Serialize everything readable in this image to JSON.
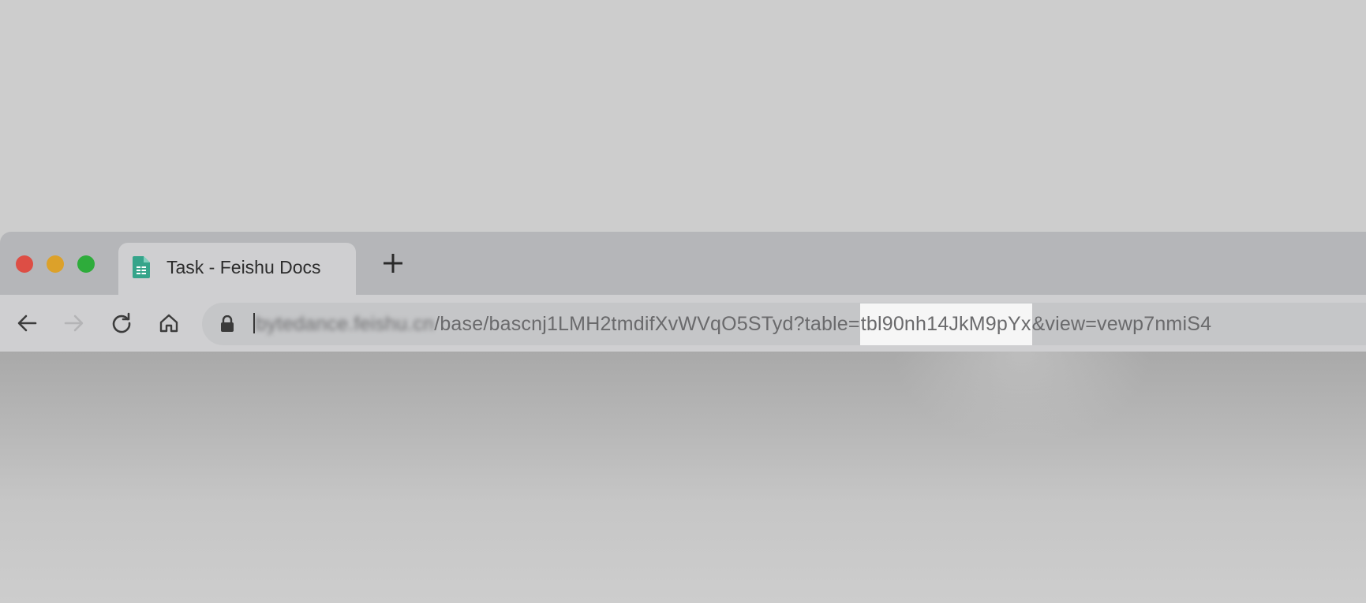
{
  "tab": {
    "title": "Task - Feishu Docs",
    "icon": "sheet-doc-icon"
  },
  "toolbar": {
    "new_tab_label": "+",
    "back_icon": "arrow-left-icon",
    "forward_icon": "arrow-right-icon",
    "reload_icon": "reload-icon",
    "home_icon": "home-icon"
  },
  "address_bar": {
    "lock_icon": "lock-icon",
    "url_host_blurred": "bytedance.feishu.cn",
    "url_path": "/base/bascnj1LMH2tmdifXvWVqO5STyd?table=",
    "url_highlight": "tbl90nh14JkM9pYx",
    "url_suffix": "&view=vewp7nmiS4"
  },
  "colors": {
    "close": "#dd4e45",
    "minimize": "#dca12a",
    "maximize": "#2eac3b",
    "doc_icon": "#35a48a",
    "highlight": "#f6f6f6"
  }
}
